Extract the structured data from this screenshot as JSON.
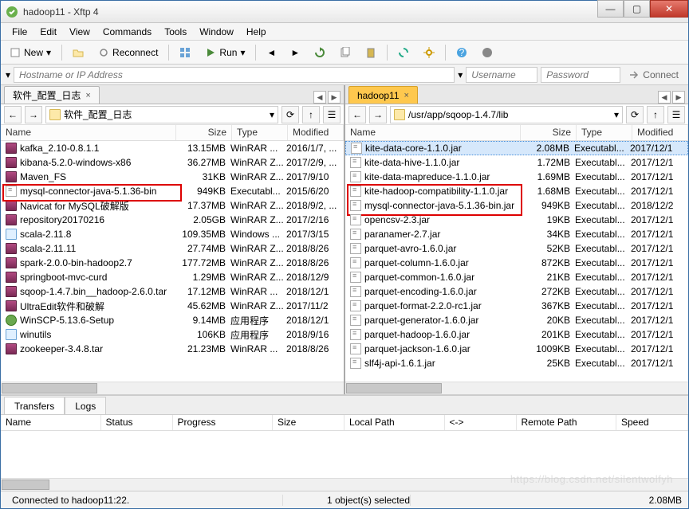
{
  "window_title": "hadoop11 - Xftp 4",
  "menu": {
    "file": "File",
    "edit": "Edit",
    "view": "View",
    "commands": "Commands",
    "tools": "Tools",
    "window": "Window",
    "help": "Help"
  },
  "toolbar": {
    "new": "New",
    "reconnect": "Reconnect",
    "run": "Run"
  },
  "hostbar": {
    "hostname_ph": "Hostname or IP Address",
    "username_ph": "Username",
    "password_ph": "Password",
    "connect": "Connect"
  },
  "left": {
    "tab": "软件_配置_日志",
    "path": "软件_配置_日志",
    "cols": {
      "name": "Name",
      "size": "Size",
      "type": "Type",
      "modified": "Modified"
    },
    "rows": [
      {
        "n": "kafka_2.10-0.8.1.1",
        "s": "13.15MB",
        "t": "WinRAR ...",
        "m": "2016/1/7, ...",
        "i": "ar"
      },
      {
        "n": "kibana-5.2.0-windows-x86",
        "s": "36.27MB",
        "t": "WinRAR Z...",
        "m": "2017/2/9, ...",
        "i": "ar"
      },
      {
        "n": "Maven_FS",
        "s": "31KB",
        "t": "WinRAR Z...",
        "m": "2017/9/10",
        "i": "ar"
      },
      {
        "n": "mysql-connector-java-5.1.36-bin",
        "s": "949KB",
        "t": "Executabl...",
        "m": "2015/6/20",
        "i": "jr"
      },
      {
        "n": "Navicat for MySQL破解版",
        "s": "17.37MB",
        "t": "WinRAR Z...",
        "m": "2018/9/2, ...",
        "i": "ar"
      },
      {
        "n": "repository20170216",
        "s": "2.05GB",
        "t": "WinRAR Z...",
        "m": "2017/2/16",
        "i": "ar"
      },
      {
        "n": "scala-2.11.8",
        "s": "109.35MB",
        "t": "Windows ...",
        "m": "2017/3/15",
        "i": "ex"
      },
      {
        "n": "scala-2.11.11",
        "s": "27.74MB",
        "t": "WinRAR Z...",
        "m": "2018/8/26",
        "i": "ar"
      },
      {
        "n": "spark-2.0.0-bin-hadoop2.7",
        "s": "177.72MB",
        "t": "WinRAR Z...",
        "m": "2018/8/26",
        "i": "ar"
      },
      {
        "n": "springboot-mvc-curd",
        "s": "1.29MB",
        "t": "WinRAR Z...",
        "m": "2018/12/9",
        "i": "ar"
      },
      {
        "n": "sqoop-1.4.7.bin__hadoop-2.6.0.tar",
        "s": "17.12MB",
        "t": "WinRAR ...",
        "m": "2018/12/1",
        "i": "ar"
      },
      {
        "n": "UltraEdit软件和破解",
        "s": "45.62MB",
        "t": "WinRAR Z...",
        "m": "2017/11/2",
        "i": "ar"
      },
      {
        "n": "WinSCP-5.13.6-Setup",
        "s": "9.14MB",
        "t": "应用程序",
        "m": "2018/12/1",
        "i": "gr"
      },
      {
        "n": "winutils",
        "s": "106KB",
        "t": "应用程序",
        "m": "2018/9/16",
        "i": "ex"
      },
      {
        "n": "zookeeper-3.4.8.tar",
        "s": "21.23MB",
        "t": "WinRAR ...",
        "m": "2018/8/26",
        "i": "ar"
      }
    ]
  },
  "right": {
    "tab": "hadoop11",
    "path": "/usr/app/sqoop-1.4.7/lib",
    "cols": {
      "name": "Name",
      "size": "Size",
      "type": "Type",
      "modified": "Modified"
    },
    "rows": [
      {
        "n": "kite-data-core-1.1.0.jar",
        "s": "2.08MB",
        "t": "Executabl...",
        "m": "2017/12/1",
        "i": "jr",
        "sel": true
      },
      {
        "n": "kite-data-hive-1.1.0.jar",
        "s": "1.72MB",
        "t": "Executabl...",
        "m": "2017/12/1",
        "i": "jr"
      },
      {
        "n": "kite-data-mapreduce-1.1.0.jar",
        "s": "1.69MB",
        "t": "Executabl...",
        "m": "2017/12/1",
        "i": "jr"
      },
      {
        "n": "kite-hadoop-compatibility-1.1.0.jar",
        "s": "1.68MB",
        "t": "Executabl...",
        "m": "2017/12/1",
        "i": "jr"
      },
      {
        "n": "mysql-connector-java-5.1.36-bin.jar",
        "s": "949KB",
        "t": "Executabl...",
        "m": "2018/12/2",
        "i": "jr"
      },
      {
        "n": "opencsv-2.3.jar",
        "s": "19KB",
        "t": "Executabl...",
        "m": "2017/12/1",
        "i": "jr"
      },
      {
        "n": "paranamer-2.7.jar",
        "s": "34KB",
        "t": "Executabl...",
        "m": "2017/12/1",
        "i": "jr"
      },
      {
        "n": "parquet-avro-1.6.0.jar",
        "s": "52KB",
        "t": "Executabl...",
        "m": "2017/12/1",
        "i": "jr"
      },
      {
        "n": "parquet-column-1.6.0.jar",
        "s": "872KB",
        "t": "Executabl...",
        "m": "2017/12/1",
        "i": "jr"
      },
      {
        "n": "parquet-common-1.6.0.jar",
        "s": "21KB",
        "t": "Executabl...",
        "m": "2017/12/1",
        "i": "jr"
      },
      {
        "n": "parquet-encoding-1.6.0.jar",
        "s": "272KB",
        "t": "Executabl...",
        "m": "2017/12/1",
        "i": "jr"
      },
      {
        "n": "parquet-format-2.2.0-rc1.jar",
        "s": "367KB",
        "t": "Executabl...",
        "m": "2017/12/1",
        "i": "jr"
      },
      {
        "n": "parquet-generator-1.6.0.jar",
        "s": "20KB",
        "t": "Executabl...",
        "m": "2017/12/1",
        "i": "jr"
      },
      {
        "n": "parquet-hadoop-1.6.0.jar",
        "s": "201KB",
        "t": "Executabl...",
        "m": "2017/12/1",
        "i": "jr"
      },
      {
        "n": "parquet-jackson-1.6.0.jar",
        "s": "1009KB",
        "t": "Executabl...",
        "m": "2017/12/1",
        "i": "jr"
      },
      {
        "n": "slf4j-api-1.6.1.jar",
        "s": "25KB",
        "t": "Executabl...",
        "m": "2017/12/1",
        "i": "jr"
      }
    ]
  },
  "transfers": {
    "tab_transfers": "Transfers",
    "tab_logs": "Logs",
    "cols": {
      "name": "Name",
      "status": "Status",
      "progress": "Progress",
      "size": "Size",
      "local": "Local Path",
      "dir": "<->",
      "remote": "Remote Path",
      "speed": "Speed"
    }
  },
  "status": {
    "conn": "Connected to hadoop11:22.",
    "sel": "1 object(s) selected",
    "size": "2.08MB"
  },
  "watermark": "https://blog.csdn.net/silentwolfyh"
}
